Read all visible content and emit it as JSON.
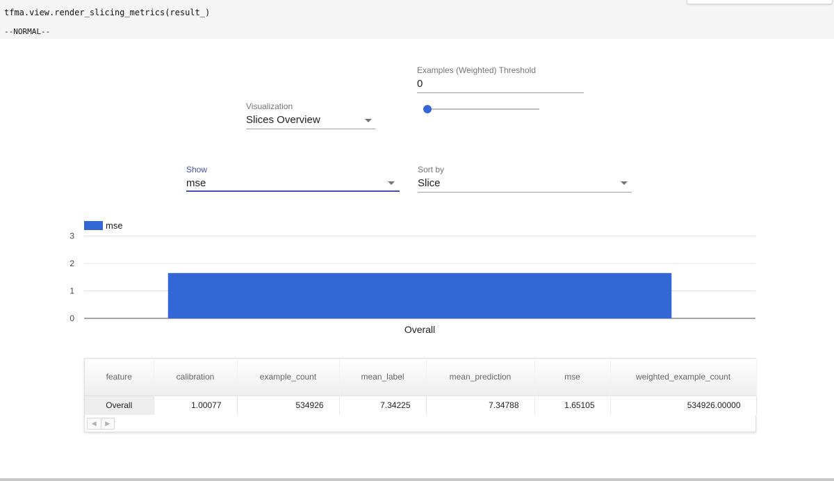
{
  "notebook": {
    "code": "tfma.view.render_slicing_metrics(result_)",
    "mode": "--NORMAL--"
  },
  "controls": {
    "threshold": {
      "label": "Examples (Weighted) Threshold",
      "value": "0",
      "slider_fraction": 0
    },
    "visualization": {
      "label": "Visualization",
      "value": "Slices Overview"
    },
    "show": {
      "label": "Show",
      "value": "mse"
    },
    "sort_by": {
      "label": "Sort by",
      "value": "Slice"
    }
  },
  "colors": {
    "bar": "#3367d6",
    "accent": "#3f51b5"
  },
  "chart_data": {
    "type": "bar",
    "categories": [
      "Overall"
    ],
    "series": [
      {
        "name": "mse",
        "values": [
          1.65105
        ]
      }
    ],
    "ylim": [
      0,
      3
    ],
    "yticks": [
      0,
      1,
      2,
      3
    ],
    "grid": true,
    "legend": "top-left"
  },
  "table": {
    "columns": [
      "feature",
      "calibration",
      "example_count",
      "mean_label",
      "mean_prediction",
      "mse",
      "weighted_example_count"
    ],
    "rows": [
      [
        "Overall",
        "1.00077",
        "534926",
        "7.34225",
        "7.34788",
        "1.65105",
        "534926.00000"
      ]
    ],
    "scroll_left_icon": "◀",
    "scroll_right_icon": "▶"
  }
}
